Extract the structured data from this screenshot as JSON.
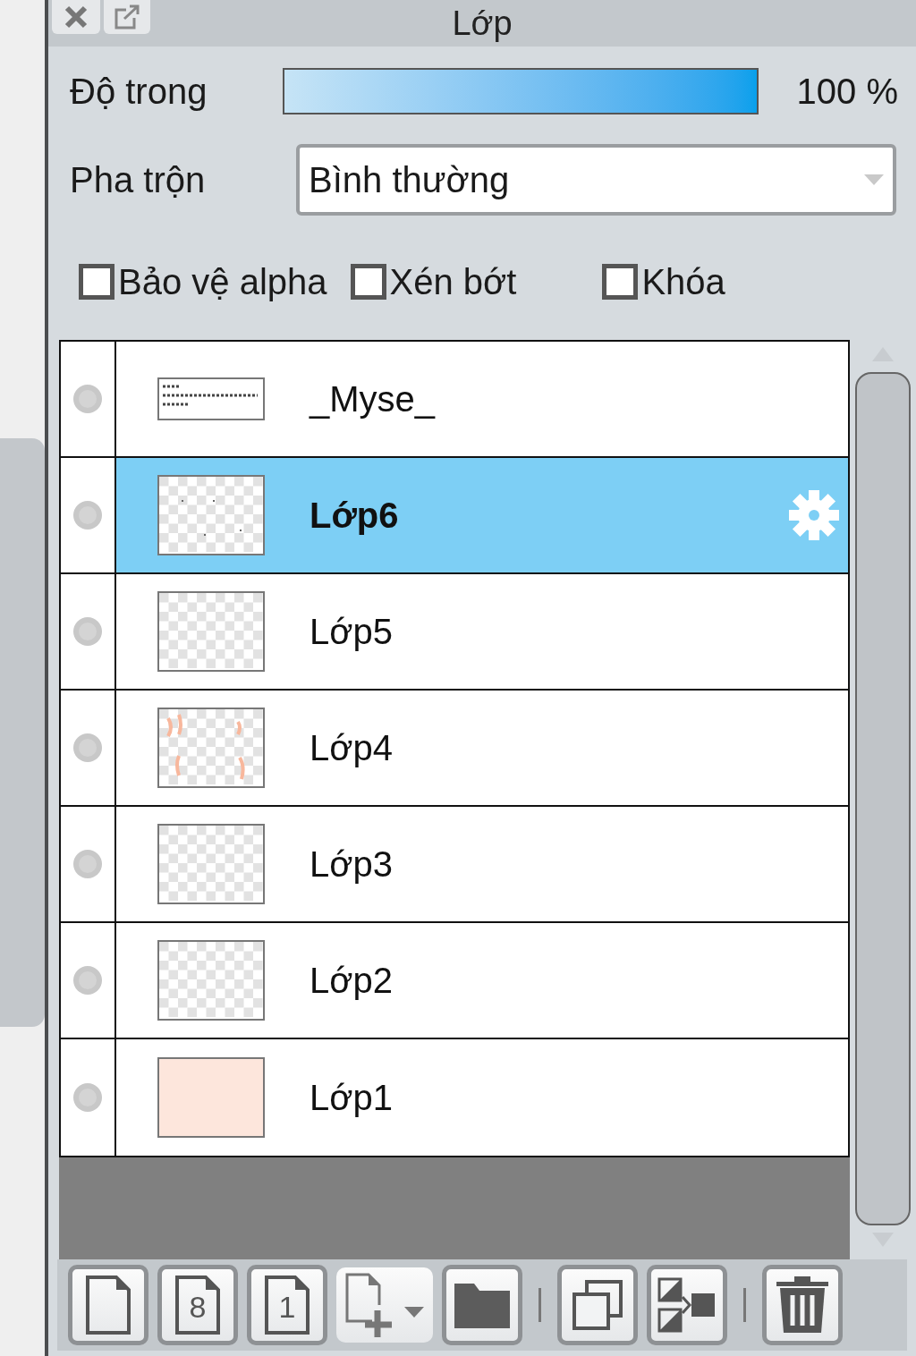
{
  "panel": {
    "title": "Lớp"
  },
  "opacity": {
    "label": "Độ trong",
    "level": 1,
    "reading": "100 %"
  },
  "blend": {
    "label": "Pha trộn",
    "value": "Bình thường"
  },
  "options": [
    {
      "label": "Bảo vệ alpha",
      "checked": false
    },
    {
      "label": "Xén bớt",
      "checked": false
    },
    {
      "label": "Khóa",
      "checked": false
    }
  ],
  "layers": [
    {
      "name": "_Myse_",
      "selected": false,
      "kind": "text"
    },
    {
      "name": "Lớp6",
      "selected": true,
      "kind": "dots"
    },
    {
      "name": "Lớp5",
      "selected": false,
      "kind": "empty"
    },
    {
      "name": "Lớp4",
      "selected": false,
      "kind": "marks"
    },
    {
      "name": "Lớp3",
      "selected": false,
      "kind": "empty"
    },
    {
      "name": "Lớp2",
      "selected": false,
      "kind": "empty"
    },
    {
      "name": "Lớp1",
      "selected": false,
      "kind": "solid"
    }
  ],
  "toolbar": [
    {
      "kind": "new"
    },
    {
      "kind": "page-number",
      "label": "8"
    },
    {
      "kind": "page-number",
      "label": "1"
    },
    {
      "kind": "add-menu"
    },
    {
      "kind": "folder"
    },
    {
      "kind": "separator"
    },
    {
      "kind": "duplicate"
    },
    {
      "kind": "merge"
    },
    {
      "kind": "separator"
    },
    {
      "kind": "delete"
    }
  ]
}
